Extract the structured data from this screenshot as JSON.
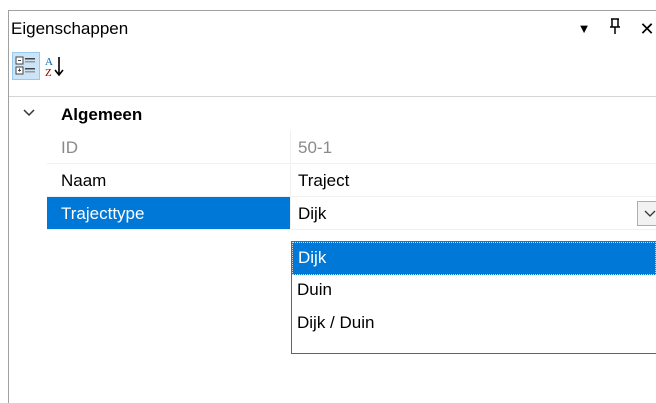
{
  "panel": {
    "title": "Eigenschappen",
    "dropdown_icon": "caret-down-icon",
    "pin_icon": "pin-icon",
    "close_icon": "close-icon"
  },
  "toolbar": {
    "categorized_icon": "categorized-view-icon",
    "alphabetical_icon": "sort-az-icon"
  },
  "grid": {
    "category": {
      "label": "Algemeen",
      "expanded": true
    },
    "rows": [
      {
        "name": "ID",
        "value": "50-1",
        "readonly": true
      },
      {
        "name": "Naam",
        "value": "Traject",
        "readonly": false
      },
      {
        "name": "Trajecttype",
        "value": "Dijk",
        "readonly": false,
        "selected": true
      }
    ]
  },
  "dropdown": {
    "options": [
      "Dijk",
      "Duin",
      "Dijk / Duin"
    ],
    "selected": "Dijk"
  },
  "colors": {
    "selection": "#0078d7",
    "readonly_text": "#8a8a8a"
  }
}
